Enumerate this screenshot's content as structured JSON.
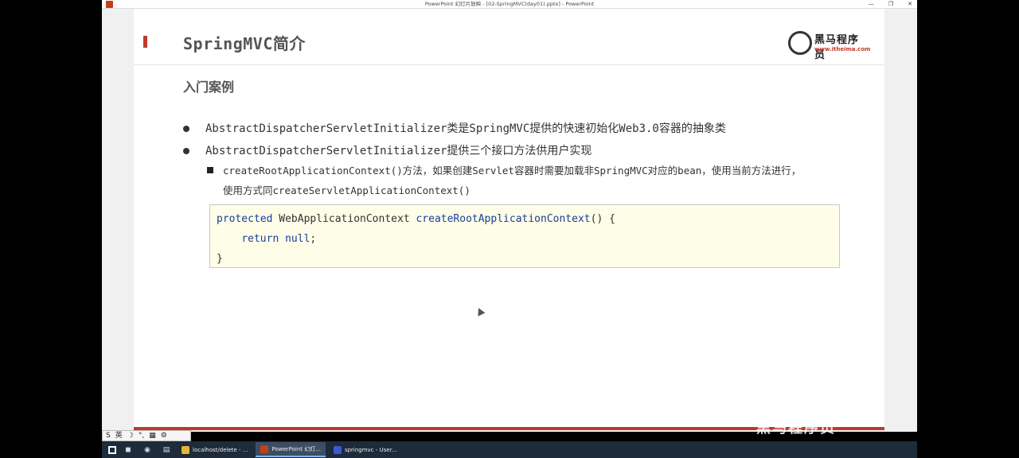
{
  "window": {
    "title": "PowerPoint 幻灯片放映 - [02-SpringMVC(day01).pptx] - PowerPoint",
    "controls": [
      "—",
      "❐",
      "✕"
    ]
  },
  "slide": {
    "title": "SpringMVC简介",
    "logo_text": "黑马程序员",
    "logo_url": "www.itheima.com",
    "subtitle": "入门案例",
    "bullets": [
      "AbstractDispatcherServletInitializer类是SpringMVC提供的快速初始化Web3.0容器的抽象类",
      "AbstractDispatcherServletInitializer提供三个接口方法供用户实现"
    ],
    "sub_bullet": {
      "line1": "createRootApplicationContext()方法，如果创建Servlet容器时需要加载非SpringMVC对应的bean，使用当前方法进行，",
      "line2": "使用方式同createServletApplicationContext()"
    },
    "code": {
      "kw_protected": "protected",
      "type": " WebApplicationContext ",
      "method": "createRootApplicationContext",
      "sig_tail": "() {",
      "indent": "    ",
      "kw_return": "return",
      "kw_null": " null",
      "semi": ";",
      "close": "}"
    }
  },
  "ime": {
    "items": [
      "S",
      "英",
      "☽",
      "°,",
      "▦",
      "⚙"
    ]
  },
  "watermark": "黑马程序员",
  "taskbar": {
    "tasks": [
      {
        "label": "localhost/delete - ...",
        "color": "#e8b43a",
        "active": false
      },
      {
        "label": "PowerPoint 幻灯...",
        "color": "#c43e1c",
        "active": true
      },
      {
        "label": "springmvc - User...",
        "color": "#3a5bcf",
        "active": false
      }
    ]
  }
}
